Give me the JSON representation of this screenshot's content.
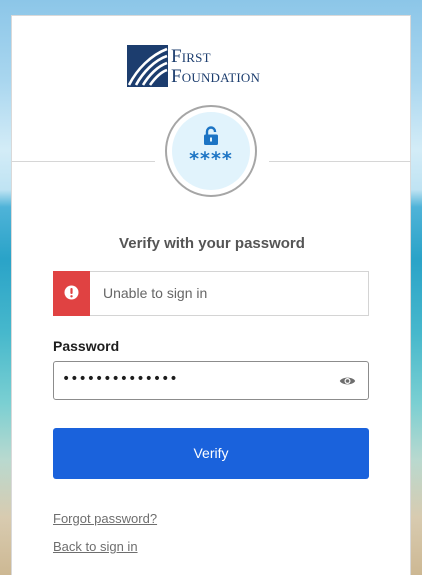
{
  "brand": {
    "logo_line1": "First",
    "logo_line2": "Foundation",
    "navy": "#1c3d6e"
  },
  "auth_icon": {
    "icon": "unlock-icon",
    "masked_text": "****"
  },
  "title": "Verify with your password",
  "error": {
    "icon": "alert-icon",
    "message": "Unable to sign in",
    "color": "#e04242"
  },
  "password": {
    "label": "Password",
    "value": "••••••••••••••",
    "toggle_icon": "eye-icon"
  },
  "verify_button": {
    "label": "Verify",
    "color": "#1a62dc"
  },
  "links": {
    "forgot_password": "Forgot password?",
    "back_to_sign_in": "Back to sign in"
  }
}
